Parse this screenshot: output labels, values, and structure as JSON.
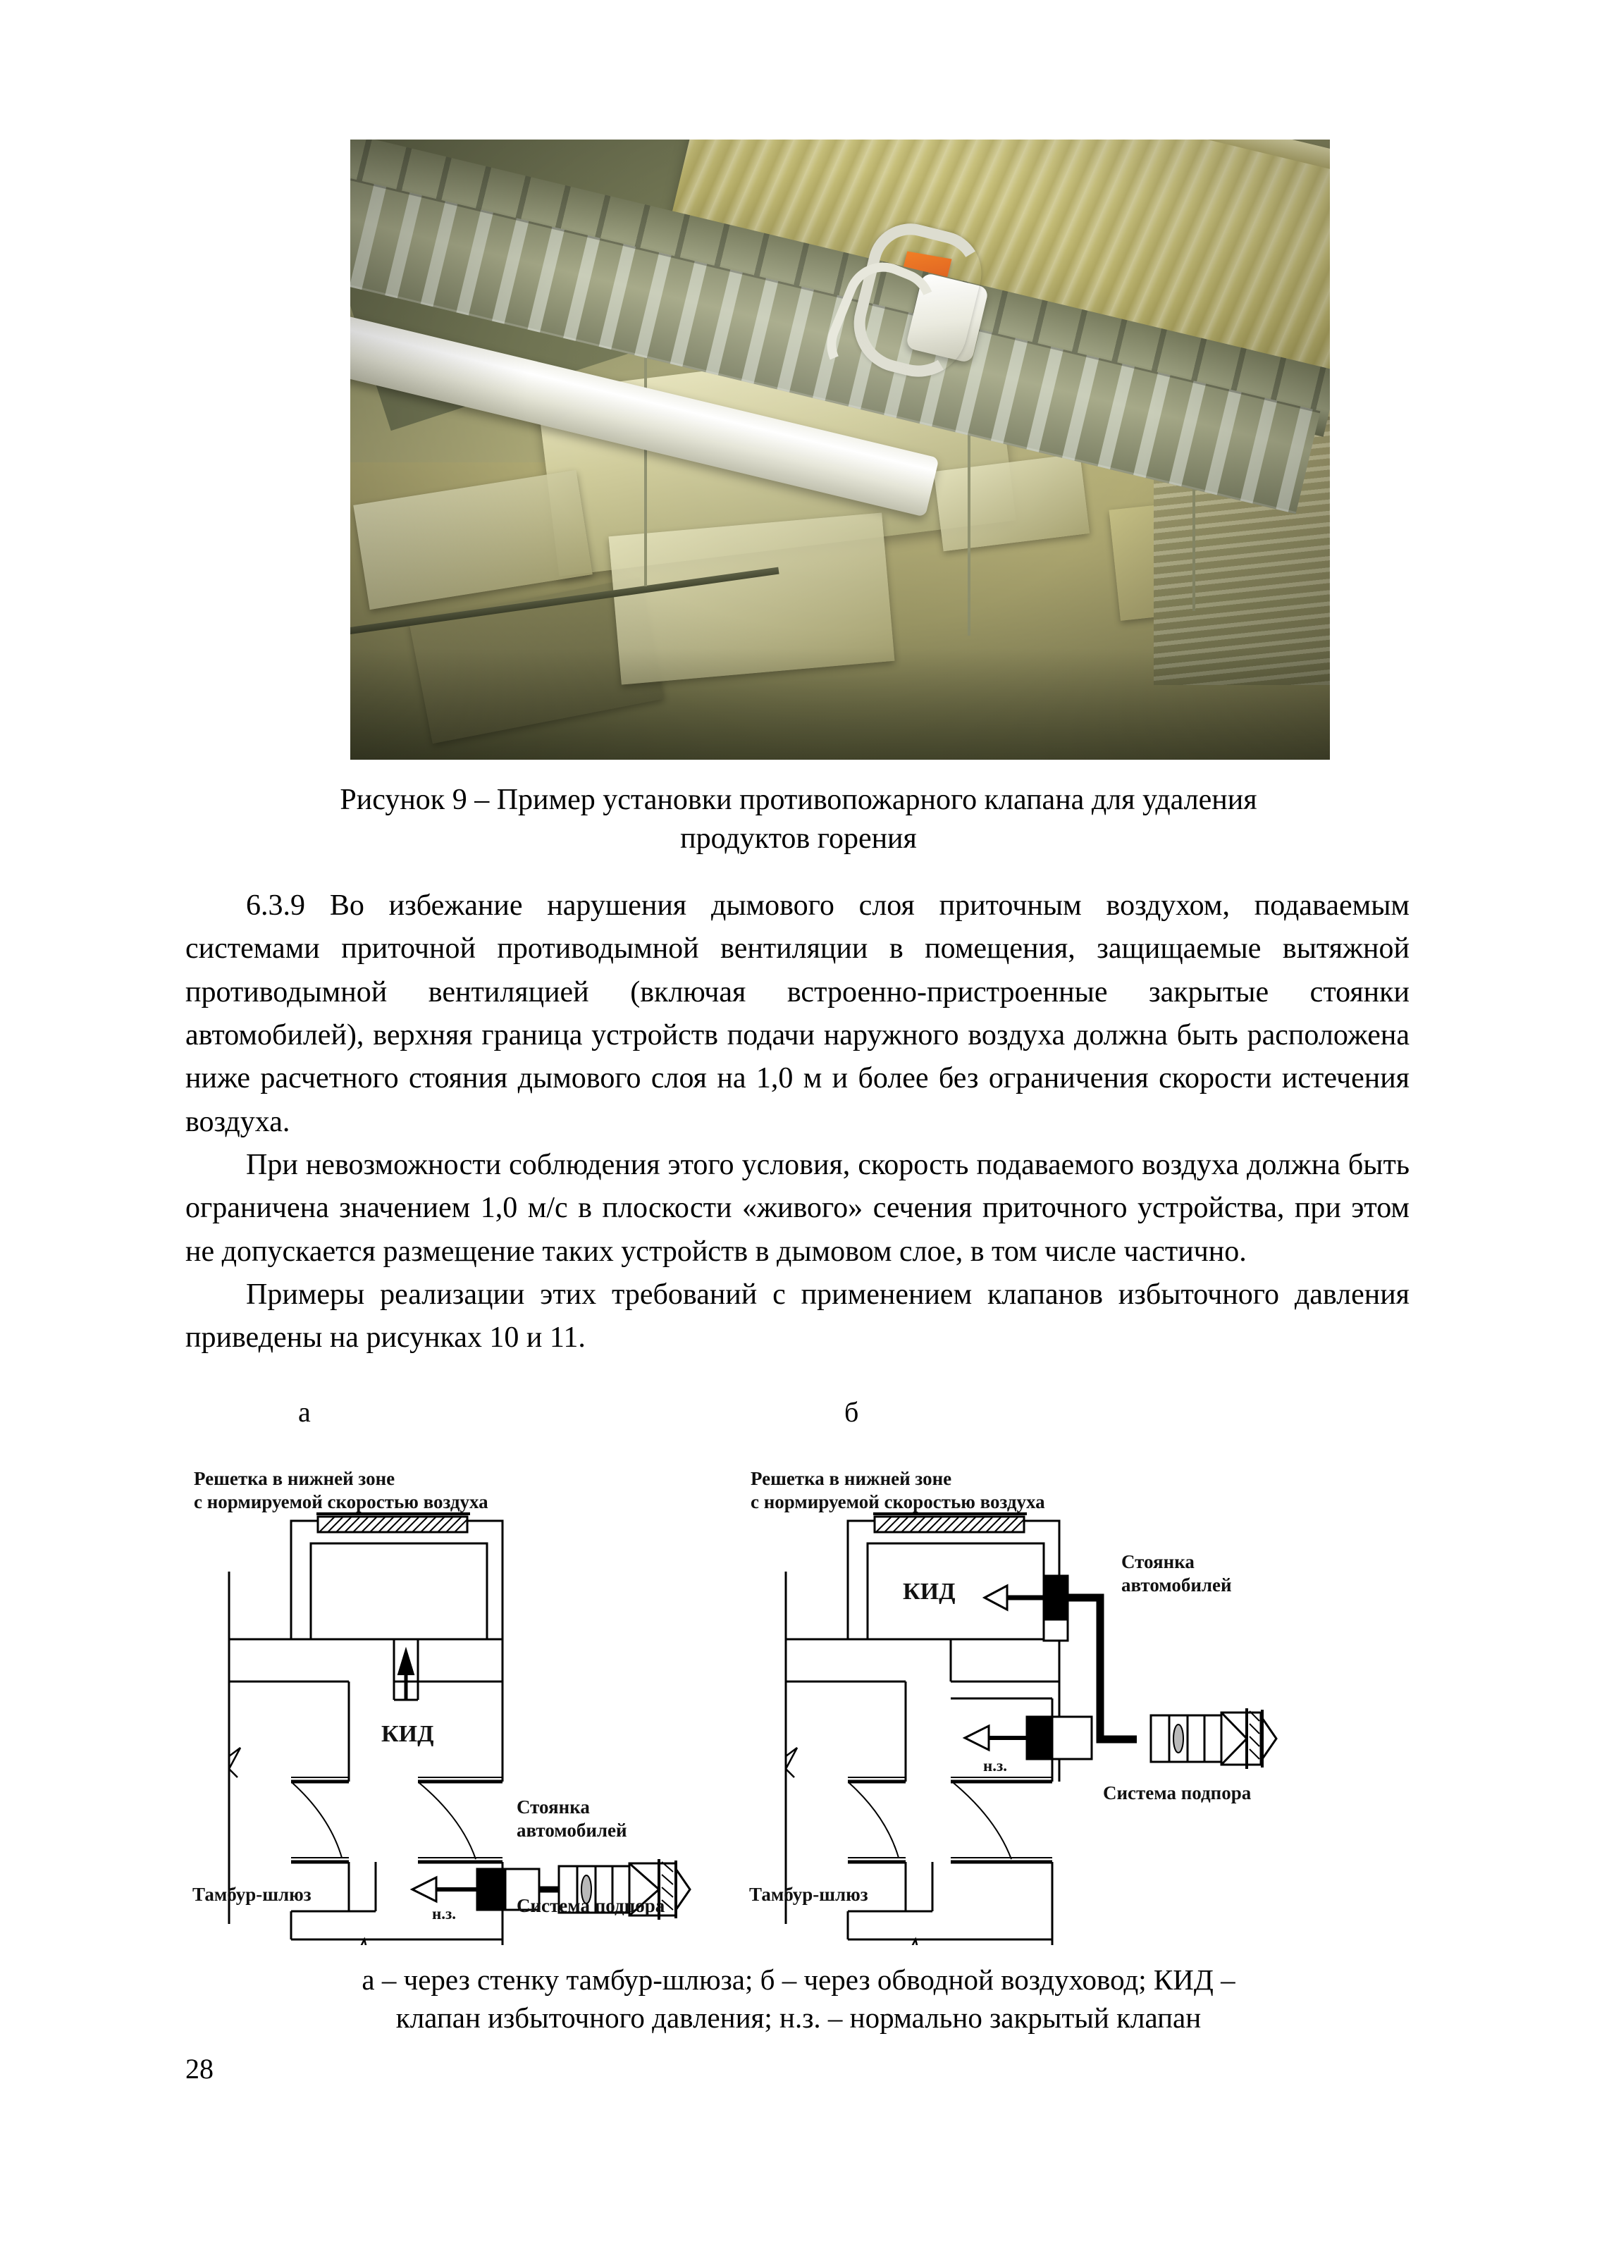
{
  "page": {
    "number": "28"
  },
  "figure9": {
    "caption_line1": "Рисунок 9 – Пример установки противопожарного клапана для удаления",
    "caption_line2": "продуктов горения",
    "photo_alt": "Фотография смонтированного противопожарного клапана на изолированном воздуховоде под перекрытием"
  },
  "body": {
    "paragraphs": [
      "6.3.9 Во избежание нарушения дымового слоя приточным воздухом, подаваемым системами приточной противодымной вентиляции в помещения, защищаемые вытяжной противодымной вентиляцией (включая встроенно-пристроенные закрытые стоянки автомобилей), верхняя граница устройств подачи наружного воздуха должна быть расположена ниже расчетного стояния дымового слоя на 1,0 м и более без ограничения скорости истечения воздуха.",
      "При невозможности соблюдения этого условия, скорость подаваемого воздуха должна быть ограничена значением 1,0 м/с в плоскости «живого» сечения приточного устройства, при этом не допускается размещение таких устройств в дымовом слое, в том числе частично.",
      "Примеры реализации этих требований с применением клапанов избыточного давления приведены на рисунках 10 и 11."
    ]
  },
  "figure10": {
    "letter_a": "а",
    "letter_b": "б",
    "diagram_a": {
      "grille_label": "Решетка в нижней зоне\nс нормируемой скоростью воздуха",
      "kid_label": "КИД",
      "parking_label": "Стоянка\nавтомобилей",
      "vestibule_label": "Тамбур-шлюз",
      "pressurization_label": "Система подпора",
      "nz_label": "н.з."
    },
    "diagram_b": {
      "grille_label": "Решетка в нижней зоне\nс нормируемой скоростью воздуха",
      "kid_label": "КИД",
      "parking_label": "Стоянка\nавтомобилей",
      "vestibule_label": "Тамбур-шлюз",
      "pressurization_label": "Система подпора",
      "nz_label": "н.з."
    },
    "caption_line1": "а – через стенку тамбур-шлюза; б – через обводной воздуховод; КИД –",
    "caption_line2": "клапан избыточного давления; н.з. – нормально закрытый клапан"
  },
  "colors": {
    "ink": "#000000",
    "paper": "#ffffff",
    "actuator_orange": "#e4661c",
    "insulation_gold": "#cfc77f"
  }
}
